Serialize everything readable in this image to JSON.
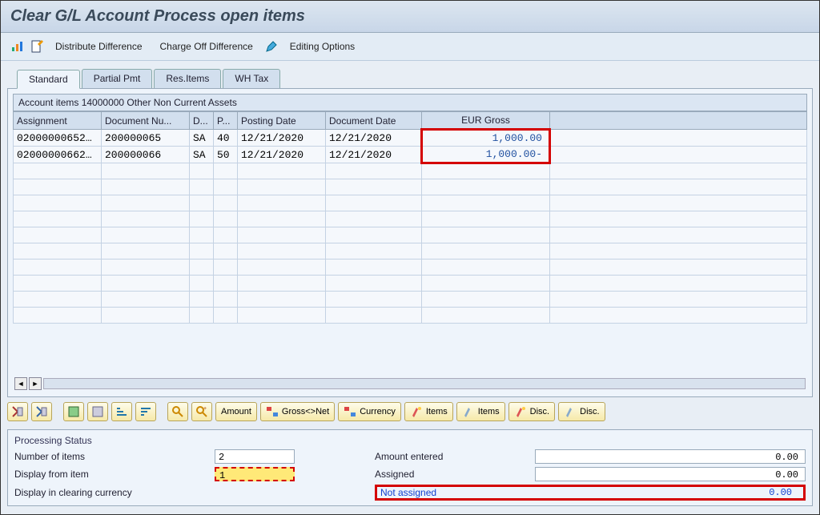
{
  "title": "Clear G/L Account Process open items",
  "toolbar": {
    "distribute": "Distribute Difference",
    "chargeoff": "Charge Off Difference",
    "editing": "Editing Options"
  },
  "tabs": [
    "Standard",
    "Partial Pmt",
    "Res.Items",
    "WH Tax"
  ],
  "panel_title": "Account items 14000000 Other Non Current Assets",
  "columns": [
    "Assignment",
    "Document Nu...",
    "D...",
    "P...",
    "Posting Date",
    "Document Date",
    "EUR Gross"
  ],
  "rows": [
    {
      "assign": "02000000652…",
      "doc": "200000065",
      "dt": "SA",
      "pk": "40",
      "pdate": "12/21/2020",
      "ddate": "12/21/2020",
      "amt": "1,000.00 "
    },
    {
      "assign": "02000000662…",
      "doc": "200000066",
      "dt": "SA",
      "pk": "50",
      "pdate": "12/21/2020",
      "ddate": "12/21/2020",
      "amt": "1,000.00-"
    }
  ],
  "action_labels": {
    "amount": "Amount",
    "grossnet": "Gross<>Net",
    "currency": "Currency",
    "items": "Items",
    "disc": "Disc."
  },
  "status": {
    "header": "Processing Status",
    "num_items_lbl": "Number of items",
    "num_items_val": "2",
    "display_from_lbl": "Display from item",
    "display_from_val": "1",
    "display_curr_lbl": "Display in clearing currency",
    "amount_entered_lbl": "Amount entered",
    "amount_entered_val": "0.00",
    "assigned_lbl": "Assigned",
    "assigned_val": "0.00",
    "not_assigned_lbl": "Not assigned",
    "not_assigned_val": "0.00"
  }
}
